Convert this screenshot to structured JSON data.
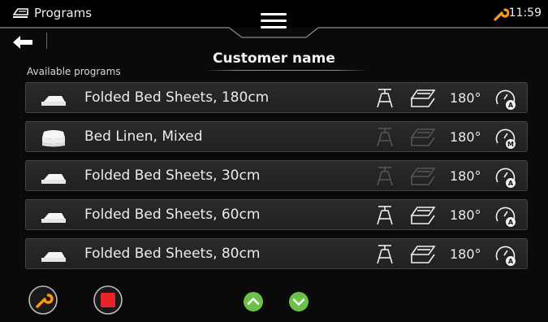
{
  "header": {
    "title": "Programs",
    "time": "11:59"
  },
  "customer_name": "Customer name",
  "available_label": "Available programs",
  "programs": [
    {
      "name": "Folded Bed Sheets, 180cm",
      "temp": "180°",
      "mode": "A",
      "thumb": "folded-sheets-icon",
      "options_enabled": true
    },
    {
      "name": "Bed Linen, Mixed",
      "temp": "180°",
      "mode": "M",
      "thumb": "bed-linen-stack-icon",
      "options_enabled": false
    },
    {
      "name": "Folded Bed Sheets, 30cm",
      "temp": "180°",
      "mode": "A",
      "thumb": "folded-sheets-icon",
      "options_enabled": false
    },
    {
      "name": "Folded Bed Sheets, 60cm",
      "temp": "180°",
      "mode": "A",
      "thumb": "folded-sheets-icon",
      "options_enabled": true
    },
    {
      "name": "Folded Bed Sheets, 80cm",
      "temp": "180°",
      "mode": "A",
      "thumb": "folded-sheets-icon",
      "options_enabled": true
    }
  ],
  "colors": {
    "accent_orange": "#f59a1b",
    "stop_red": "#e8232a",
    "scroll_green": "#6cc04a",
    "disabled_grey": "#555555"
  }
}
